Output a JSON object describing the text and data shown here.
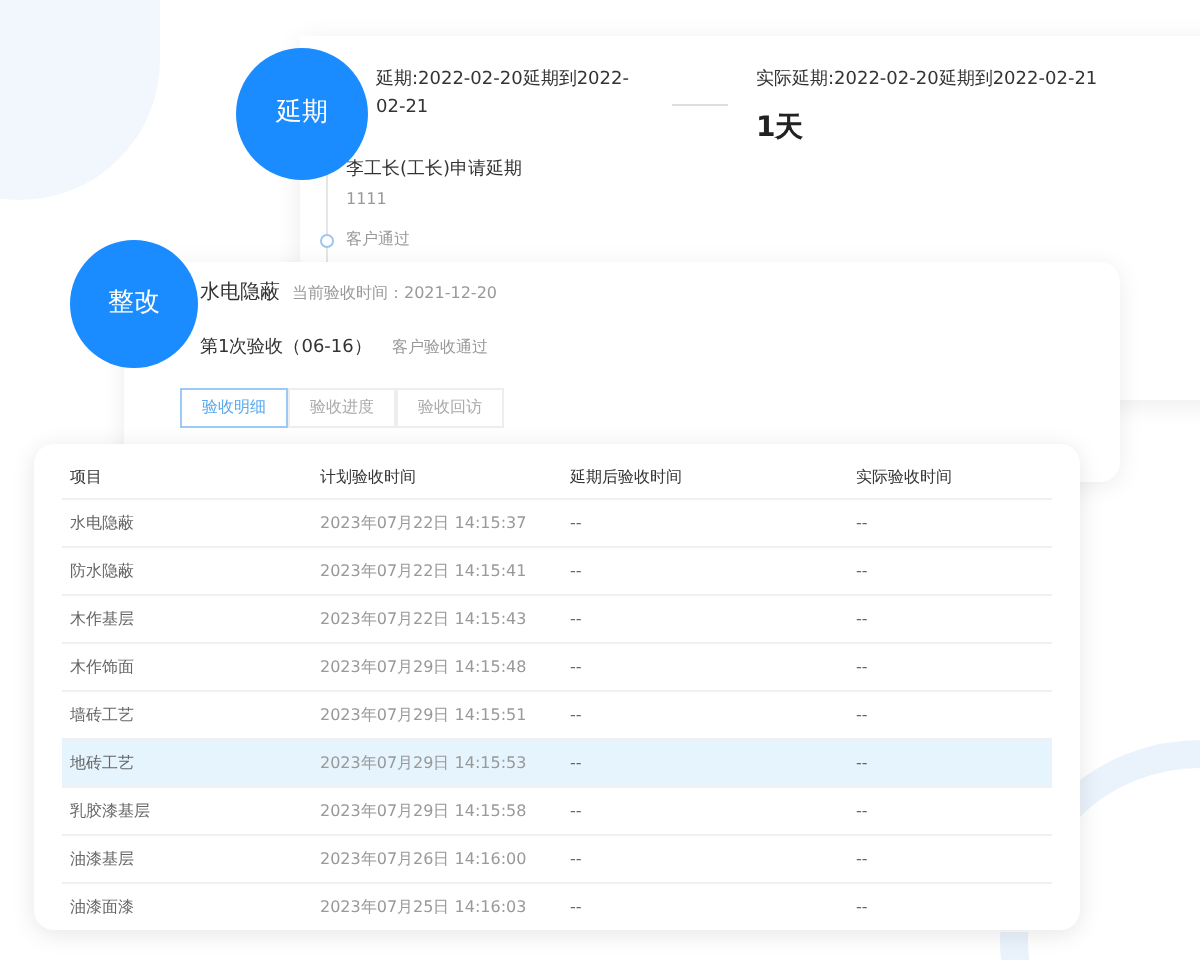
{
  "delay_card": {
    "badge": "延期",
    "planned": "延期:2022-02-20延期到2022-02-21",
    "actual": "实际延期:2022-02-20延期到2022-02-21",
    "actual_days": "1天",
    "timeline": [
      {
        "title": "李工长(工长)申请延期",
        "note": "1111"
      },
      {
        "title": "客户通过"
      }
    ]
  },
  "rectify_card": {
    "badge": "整改",
    "title": "水电隐蔽",
    "current_time": "当前验收时间：2021-12-20",
    "round": "第1次验收（06-16）",
    "result": "客户验收通过",
    "tabs": [
      {
        "label": "验收明细",
        "selected": true
      },
      {
        "label": "验收进度",
        "selected": false
      },
      {
        "label": "验收回访",
        "selected": false
      }
    ]
  },
  "table": {
    "columns": [
      "项目",
      "计划验收时间",
      "延期后验收时间",
      "实际验收时间"
    ],
    "rows": [
      {
        "cells": [
          "水电隐蔽",
          "2023年07月22日 14:15:37",
          "--",
          "--"
        ],
        "selected": false
      },
      {
        "cells": [
          "防水隐蔽",
          "2023年07月22日 14:15:41",
          "--",
          "--"
        ],
        "selected": false
      },
      {
        "cells": [
          "木作基层",
          "2023年07月22日 14:15:43",
          "--",
          "--"
        ],
        "selected": false
      },
      {
        "cells": [
          "木作饰面",
          "2023年07月29日 14:15:48",
          "--",
          "--"
        ],
        "selected": false
      },
      {
        "cells": [
          "墙砖工艺",
          "2023年07月29日 14:15:51",
          "--",
          "--"
        ],
        "selected": false
      },
      {
        "cells": [
          "地砖工艺",
          "2023年07月29日 14:15:53",
          "--",
          "--"
        ],
        "selected": true
      },
      {
        "cells": [
          "乳胶漆基层",
          "2023年07月29日 14:15:58",
          "--",
          "--"
        ],
        "selected": false
      },
      {
        "cells": [
          "油漆基层",
          "2023年07月26日 14:16:00",
          "--",
          "--"
        ],
        "selected": false
      },
      {
        "cells": [
          "油漆面漆",
          "2023年07月25日 14:16:03",
          "--",
          "--"
        ],
        "selected": false
      }
    ]
  }
}
